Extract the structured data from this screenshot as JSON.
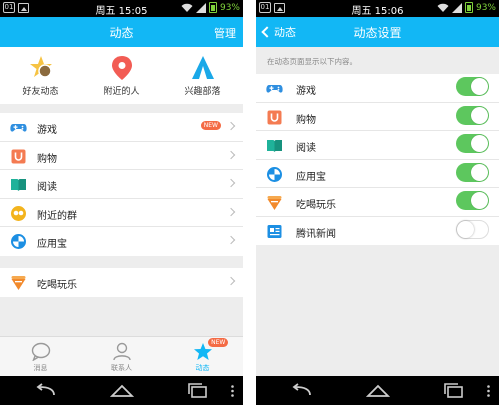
{
  "left": {
    "status": {
      "notif": "01",
      "time": "周五 15:05",
      "battery": "93%"
    },
    "title": "动态",
    "manage": "管理",
    "quick": [
      {
        "label": "好友动态",
        "icon": "friend-feed-icon"
      },
      {
        "label": "附近的人",
        "icon": "location-pin-icon"
      },
      {
        "label": "兴趣部落",
        "icon": "tribe-tent-icon"
      }
    ],
    "list1": [
      {
        "label": "游戏",
        "icon": "gamepad-icon",
        "badge": "NEW"
      },
      {
        "label": "购物",
        "icon": "shopping-bag-icon"
      },
      {
        "label": "阅读",
        "icon": "book-icon"
      },
      {
        "label": "附近的群",
        "icon": "nearby-group-icon"
      },
      {
        "label": "应用宝",
        "icon": "app-store-icon"
      }
    ],
    "list2": [
      {
        "label": "吃喝玩乐",
        "icon": "food-fun-icon"
      }
    ],
    "tabs": [
      {
        "label": "消息",
        "icon": "message-icon"
      },
      {
        "label": "联系人",
        "icon": "contacts-icon"
      },
      {
        "label": "动态",
        "icon": "star-icon",
        "badge": "NEW",
        "active": true
      }
    ]
  },
  "right": {
    "status": {
      "notif": "01",
      "time": "周五 15:06",
      "battery": "93%"
    },
    "back_label": "动态",
    "title": "动态设置",
    "hint": "在动态页面显示以下内容。",
    "settings": [
      {
        "label": "游戏",
        "icon": "gamepad-icon",
        "enabled": true
      },
      {
        "label": "购物",
        "icon": "shopping-bag-icon",
        "enabled": true
      },
      {
        "label": "阅读",
        "icon": "book-icon",
        "enabled": true
      },
      {
        "label": "应用宝",
        "icon": "app-store-icon",
        "enabled": true
      },
      {
        "label": "吃喝玩乐",
        "icon": "food-fun-icon",
        "enabled": true
      },
      {
        "label": "腾讯新闻",
        "icon": "news-icon",
        "enabled": false
      }
    ]
  },
  "colors": {
    "header": "#12b7f5",
    "toggle_on": "#5dc75e",
    "badge": "#f46b45",
    "battery": "#7fd13b"
  }
}
